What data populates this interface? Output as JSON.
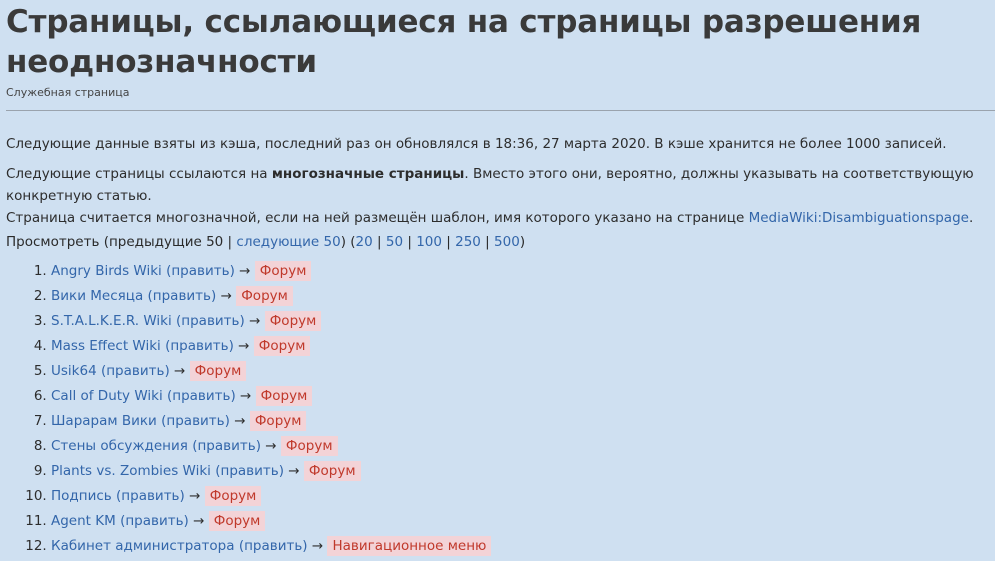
{
  "header": {
    "title": "Страницы, ссылающиеся на страницы разрешения неоднозначности",
    "subtitle": "Служебная страница"
  },
  "content": {
    "cache_note": "Следующие данные взяты из кэша, последний раз он обновлялся в 18:36, 27 марта 2020. В кэше хранится не более 1000 записей.",
    "intro_before": "Следующие страницы ссылаются на ",
    "intro_bold": "многозначные страницы",
    "intro_after": ". Вместо этого они, вероятно, должны указывать на соответствующую конкретную статью.",
    "template_before": "Страница считается многозначной, если на ней размещён шаблон, имя которого указано на странице ",
    "template_link": "MediaWiki:Disambiguationspage",
    "template_after": "."
  },
  "pager": {
    "view_prefix": "Просмотреть (предыдущие 50 | ",
    "next_link": "следующие 50",
    "mid": ") (",
    "sizes": [
      "20",
      "50",
      "100",
      "250",
      "500"
    ],
    "sep": " | ",
    "suffix": ")"
  },
  "list_meta": {
    "edit_label": "(править)",
    "arrow": "→"
  },
  "items": [
    {
      "page": "Angry Birds Wiki",
      "target": "Форум"
    },
    {
      "page": "Вики Месяца",
      "target": "Форум"
    },
    {
      "page": "S.T.A.L.K.E.R. Wiki",
      "target": "Форум"
    },
    {
      "page": "Mass Effect Wiki",
      "target": "Форум"
    },
    {
      "page": "Usik64",
      "target": "Форум"
    },
    {
      "page": "Call of Duty Wiki",
      "target": "Форум"
    },
    {
      "page": "Шарарам Вики",
      "target": "Форум"
    },
    {
      "page": "Стены обсуждения",
      "target": "Форум"
    },
    {
      "page": "Plants vs. Zombies Wiki",
      "target": "Форум"
    },
    {
      "page": "Подпись",
      "target": "Форум"
    },
    {
      "page": "Agent KM",
      "target": "Форум"
    },
    {
      "page": "Кабинет администратора",
      "target": "Навигационное меню"
    }
  ],
  "colors": {
    "link": "#3366aa",
    "tag_bg": "#f3d3d7",
    "tag_text": "#c0392b",
    "bg": "#cfe0f1"
  }
}
